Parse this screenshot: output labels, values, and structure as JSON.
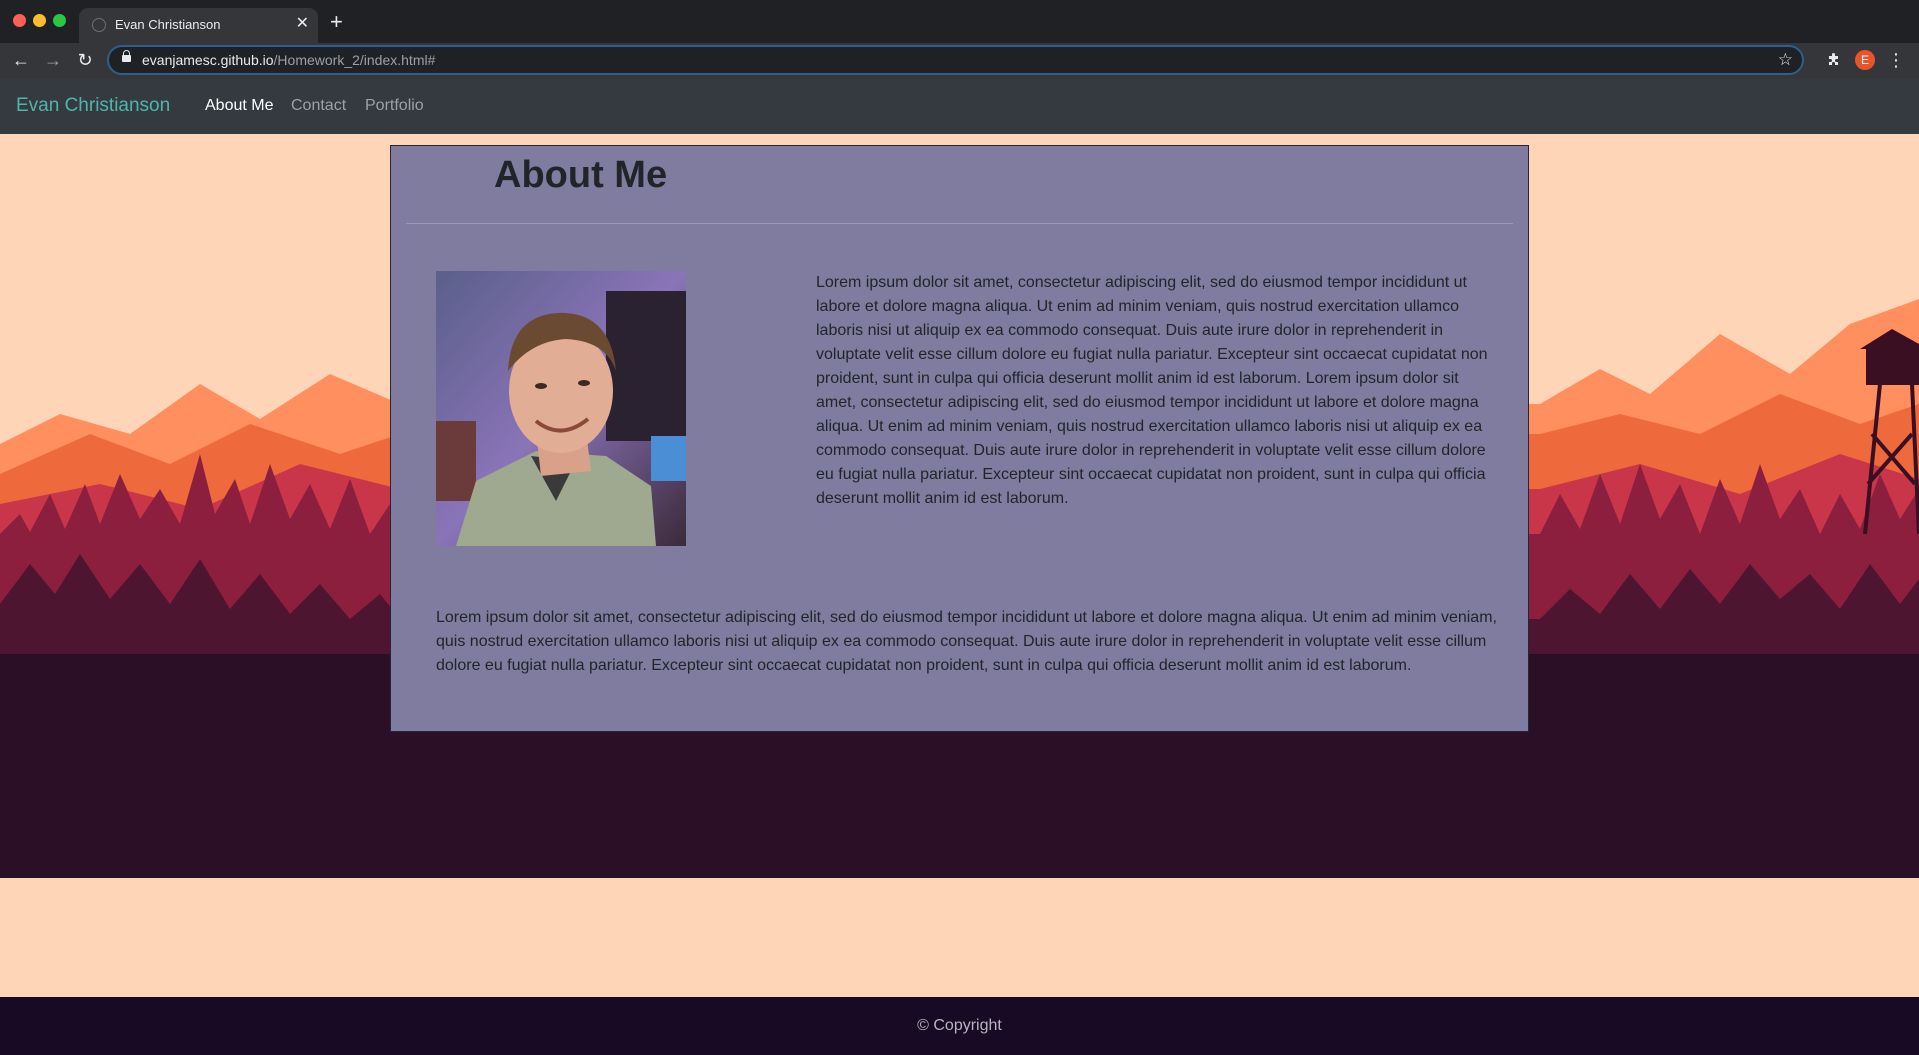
{
  "browser": {
    "tab_title": "Evan Christianson",
    "url_host": "evanjamesc.github.io",
    "url_path": "/Homework_2/index.html#",
    "profile_initial": "E"
  },
  "navbar": {
    "brand": "Evan Christianson",
    "links": [
      {
        "label": "About Me",
        "active": true
      },
      {
        "label": "Contact",
        "active": false
      },
      {
        "label": "Portfolio",
        "active": false
      }
    ]
  },
  "main": {
    "heading": "About Me",
    "photo_alt": "Photo of Evan Christianson",
    "paragraph_1": "Lorem ipsum dolor sit amet, consectetur adipiscing elit, sed do eiusmod tempor incididunt ut labore et dolore magna aliqua. Ut enim ad minim veniam, quis nostrud exercitation ullamco laboris nisi ut aliquip ex ea commodo consequat. Duis aute irure dolor in reprehenderit in voluptate velit esse cillum dolore eu fugiat nulla pariatur. Excepteur sint occaecat cupidatat non proident, sunt in culpa qui officia deserunt mollit anim id est laborum. Lorem ipsum dolor sit amet, consectetur adipiscing elit, sed do eiusmod tempor incididunt ut labore et dolore magna aliqua. Ut enim ad minim veniam, quis nostrud exercitation ullamco laboris nisi ut aliquip ex ea commodo consequat. Duis aute irure dolor in reprehenderit in voluptate velit esse cillum dolore eu fugiat nulla pariatur. Excepteur sint occaecat cupidatat non proident, sunt in culpa qui officia deserunt mollit anim id est laborum.",
    "paragraph_2": "Lorem ipsum dolor sit amet, consectetur adipiscing elit, sed do eiusmod tempor incididunt ut labore et dolore magna aliqua. Ut enim ad minim veniam, quis nostrud exercitation ullamco laboris nisi ut aliquip ex ea commodo consequat. Duis aute irure dolor in reprehenderit in voluptate velit esse cillum dolore eu fugiat nulla pariatur. Excepteur sint occaecat cupidatat non proident, sunt in culpa qui officia deserunt mollit anim id est laborum."
  },
  "footer": {
    "copyright": "© Copyright"
  },
  "colors": {
    "brand": "#4db6ac",
    "navbar_bg": "#343a40",
    "page_bg": "#ffd5b8",
    "card_bg": "#7f7ca0",
    "footer_bg": "#180a24"
  },
  "icons": [
    "globe-icon",
    "close-icon",
    "plus-icon",
    "back-arrow-icon",
    "forward-arrow-icon",
    "reload-icon",
    "lock-icon",
    "star-icon",
    "puzzle-icon",
    "kebab-menu-icon"
  ]
}
